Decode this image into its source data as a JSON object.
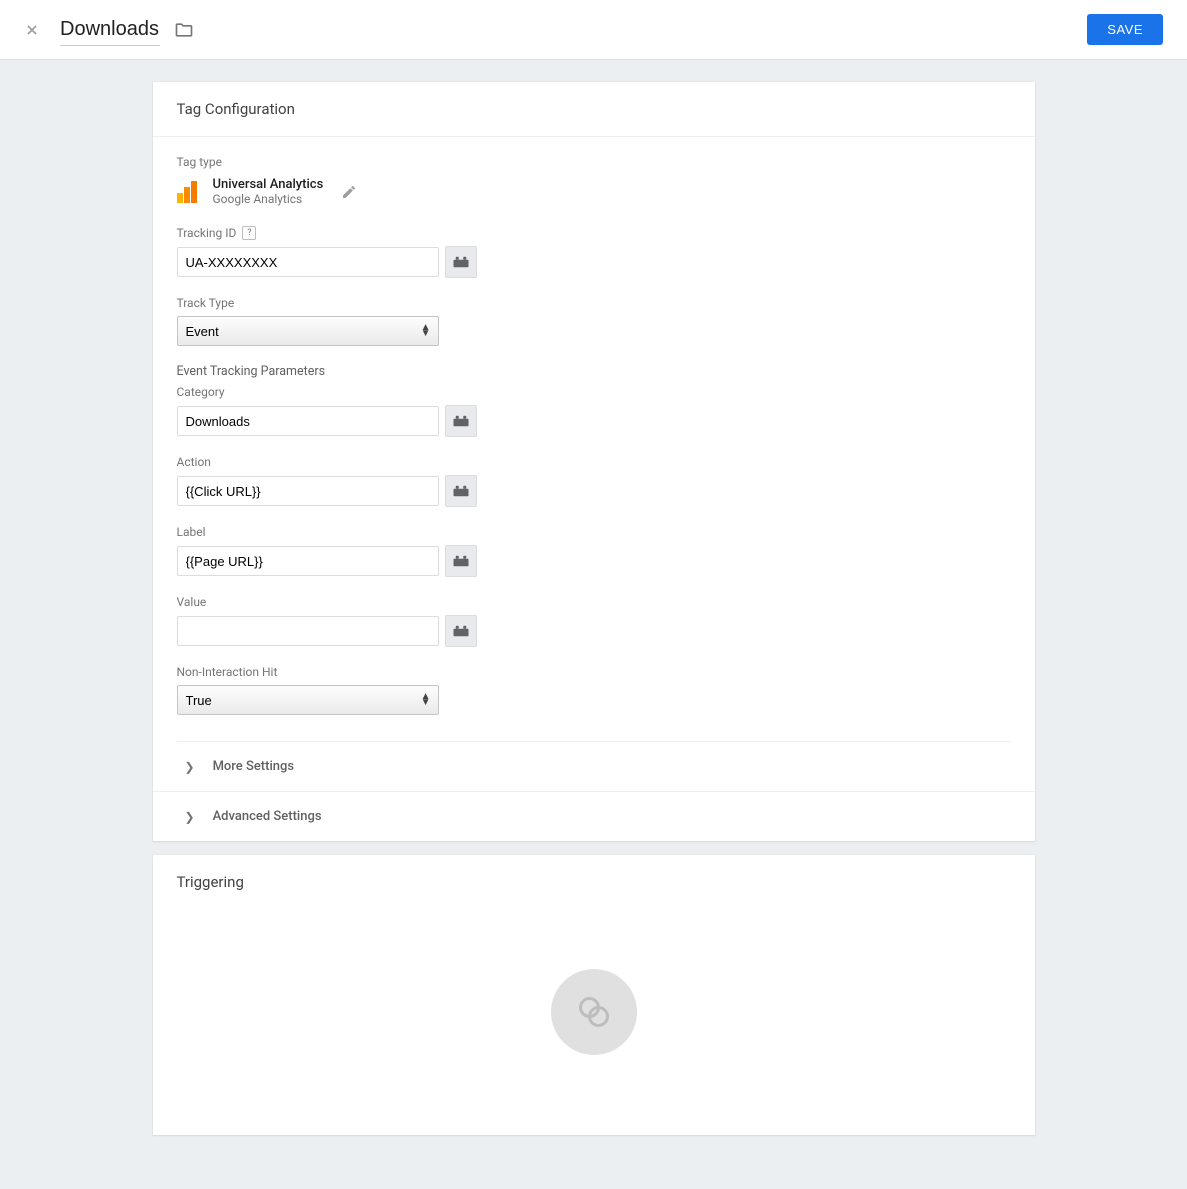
{
  "header": {
    "title": "Downloads",
    "save_label": "SAVE"
  },
  "config": {
    "card_title": "Tag Configuration",
    "tag_type_label": "Tag type",
    "tag_type_name": "Universal Analytics",
    "tag_type_sub": "Google Analytics",
    "tracking_id_label": "Tracking ID",
    "tracking_id_value": "UA-XXXXXXXX",
    "track_type_label": "Track Type",
    "track_type_value": "Event",
    "params_label": "Event Tracking Parameters",
    "category_label": "Category",
    "category_value": "Downloads",
    "action_label": "Action",
    "action_value": "{{Click URL}}",
    "label_label": "Label",
    "label_value": "{{Page URL}}",
    "value_label": "Value",
    "value_value": "",
    "noninteraction_label": "Non-Interaction Hit",
    "noninteraction_value": "True",
    "more_settings": "More Settings",
    "advanced_settings": "Advanced Settings"
  },
  "triggering": {
    "card_title": "Triggering"
  }
}
